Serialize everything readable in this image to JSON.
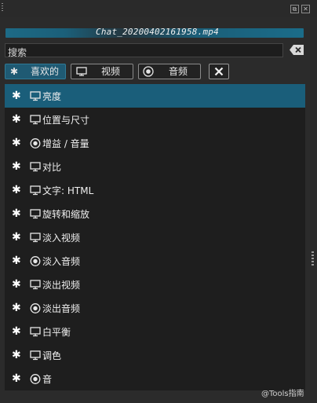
{
  "panel": {
    "title": "Chat_20200402161958.mp4",
    "watermark": "@Tools指南"
  },
  "search": {
    "placeholder": "搜索"
  },
  "filters": {
    "favorites": "喜欢的",
    "video": "视频",
    "audio": "音频"
  },
  "effects": [
    {
      "label": "亮度",
      "type": "video",
      "selected": true
    },
    {
      "label": "位置与尺寸",
      "type": "video"
    },
    {
      "label": "增益 / 音量",
      "type": "audio"
    },
    {
      "label": "对比",
      "type": "video"
    },
    {
      "label": "文字: HTML",
      "type": "video"
    },
    {
      "label": "旋转和缩放",
      "type": "video"
    },
    {
      "label": "淡入视频",
      "type": "video"
    },
    {
      "label": "淡入音频",
      "type": "audio"
    },
    {
      "label": "淡出视频",
      "type": "video"
    },
    {
      "label": "淡出音频",
      "type": "audio"
    },
    {
      "label": "白平衡",
      "type": "video"
    },
    {
      "label": "调色",
      "type": "video"
    },
    {
      "label": "音",
      "type": "audio"
    }
  ],
  "icons": {
    "favorite": "star-icon",
    "video": "monitor-icon",
    "audio": "speaker-icon"
  },
  "colors": {
    "accent": "#1a5e7a",
    "background": "#1e1e1e"
  }
}
